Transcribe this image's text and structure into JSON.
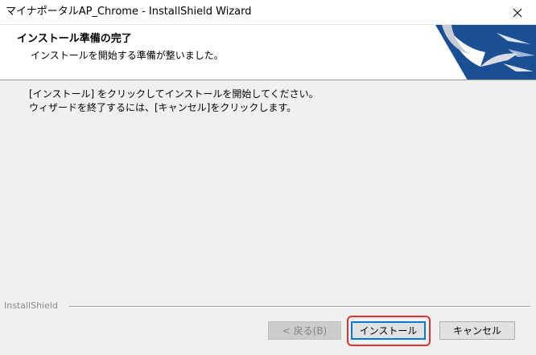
{
  "window": {
    "title": "マイナポータルAP_Chrome - InstallShield Wizard"
  },
  "header": {
    "title": "インストール準備の完了",
    "subtitle": "インストールを開始する準備が整いました。"
  },
  "body": {
    "line1": "[インストール] をクリックしてインストールを開始してください。",
    "line2": "ウィザードを終了するには、[キャンセル]をクリックします。"
  },
  "footer": {
    "brand": "InstallShield"
  },
  "buttons": {
    "back": "< 戻る(B)",
    "install": "インストール",
    "cancel": "キャンセル"
  },
  "colors": {
    "logo_blue": "#1a4f94",
    "highlight": "#e03030"
  }
}
